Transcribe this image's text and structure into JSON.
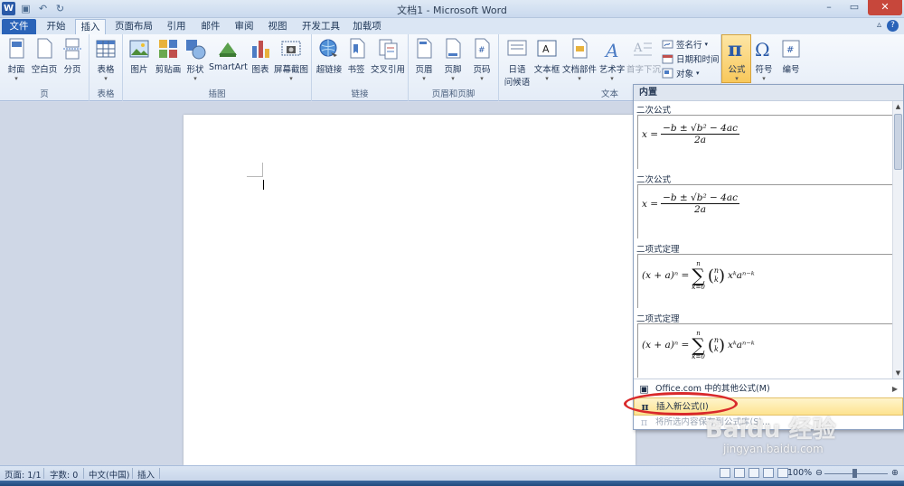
{
  "window": {
    "title": "文档1 - Microsoft Word"
  },
  "qat": {
    "logo": "W",
    "save": "▣",
    "undo": "↶",
    "redo": "↻"
  },
  "winctl": {
    "min": "–",
    "max": "▭",
    "close": "✕"
  },
  "tabs": {
    "file": "文件",
    "home": "开始",
    "insert": "插入",
    "layout": "页面布局",
    "refs": "引用",
    "mail": "邮件",
    "review": "审阅",
    "view": "视图",
    "dev": "开发工具",
    "addins": "加载项",
    "help": "?"
  },
  "ribbon": {
    "pages": {
      "label": "页",
      "cover": "封面",
      "blank": "空白页",
      "break": "分页"
    },
    "tables": {
      "label": "表格",
      "table": "表格"
    },
    "illus": {
      "label": "插图",
      "picture": "图片",
      "clipart": "剪贴画",
      "shapes": "形状",
      "smartart": "SmartArt",
      "chart": "图表",
      "screenshot": "屏幕截图"
    },
    "links": {
      "label": "链接",
      "hyperlink": "超链接",
      "bookmark": "书签",
      "crossref": "交叉引用"
    },
    "hf": {
      "label": "页眉和页脚",
      "header": "页眉",
      "footer": "页脚",
      "pagenum": "页码"
    },
    "text": {
      "label": "文本",
      "quickpart": "日语",
      "quickpart2": "问候语",
      "textbox": "文本框",
      "docparts": "文档部件",
      "wordart": "艺术字",
      "dropcap": "首字下沉",
      "sigline": "签名行",
      "datetime": "日期和时间",
      "object": "对象"
    },
    "symbols": {
      "formula": "公式",
      "symbol": "符号",
      "number": "编号"
    }
  },
  "gallery": {
    "header": "内置",
    "sections": [
      {
        "title": "二次公式"
      },
      {
        "title": "二次公式"
      },
      {
        "title": "二项式定理"
      },
      {
        "title": "二项式定理"
      }
    ],
    "quad": {
      "lhs": "x =",
      "num": "−b ± √b² − 4ac",
      "den": "2a"
    },
    "binom": {
      "lhs": "(x + a)ⁿ =",
      "upper": "n",
      "lower": "k=0",
      "bn": "n",
      "bk": "k",
      "rest": "xᵏaⁿ⁻ᵏ"
    },
    "menu": {
      "more": "Office.com 中的其他公式(M)",
      "insert_new": "插入新公式(I)",
      "save_sel": "将所选内容保存到公式库(S)..."
    }
  },
  "statusbar": {
    "page": "页面: 1/1",
    "words": "字数: 0",
    "lang": "中文(中国)",
    "mode": "插入",
    "zoom": "100%"
  },
  "watermark": {
    "brand": "Baidu 经验",
    "url": "jingyan.baidu.com"
  }
}
